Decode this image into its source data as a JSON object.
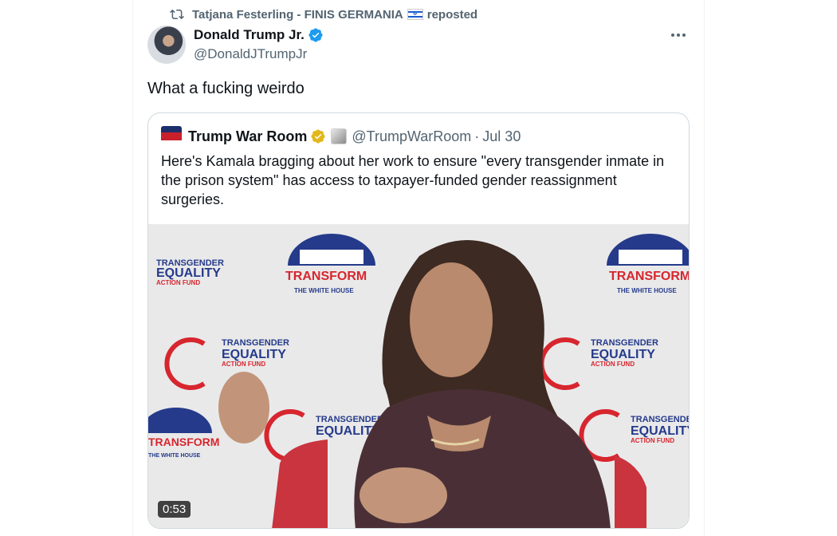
{
  "repost": {
    "user": "Tatjana Festerling - FINIS GERMANIA",
    "action": "reposted",
    "icon": "repost-icon"
  },
  "author": {
    "name": "Donald Trump Jr.",
    "handle": "@DonaldJTrumpJr",
    "verified_color": "#1d9bf0"
  },
  "tweet": {
    "text": "What a fucking weirdo"
  },
  "quoted": {
    "name": "Trump War Room",
    "handle": "@TrumpWarRoom",
    "separator": "·",
    "date": "Jul 30",
    "verified_color": "#e2b719",
    "text": "Here's Kamala bragging about her work to ensure \"every transgender inmate in the prison system\" has access to taxpayer-funded gender reassignment surgeries.",
    "video": {
      "duration": "0:53",
      "backdrop_text": {
        "equality": "EQUALITY",
        "action_fund": "ACTION FUND",
        "transgender": "TRANSGENDER",
        "transform": "TRANSFORM",
        "white_house": "THE WHITE HOUSE"
      }
    }
  },
  "colors": {
    "text": "#0f1419",
    "secondary": "#536471",
    "border": "#cfd9de",
    "logo_blue": "#253a8a",
    "logo_red": "#d7262e"
  }
}
